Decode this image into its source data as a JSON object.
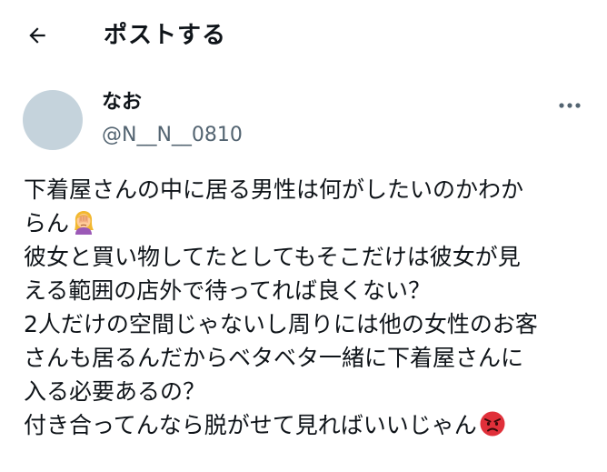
{
  "header": {
    "back_icon": "arrow-left-icon",
    "title": "ポストする"
  },
  "author": {
    "display_name": "なお",
    "handle": "@N__N__0810",
    "avatar_color": "#c5d3dc"
  },
  "more_icon": "more-horizontal-icon",
  "post": {
    "lines": [
      "下着屋さんの中に居る男性は何がしたいのかわか",
      "らん",
      "彼女と買い物してたとしてもそこだけは彼女が見",
      "える範囲の店外で待ってれば良くない？",
      "2人だけの空間じゃないし周りには他の女性のお客",
      "さんも居るんだからベタベタ一緒に下着屋さんに",
      "入る必要あるの？",
      "付き合ってんなら脱がせて見ればいいじゃん"
    ],
    "emoji_1": "facepalm-woman-emoji",
    "emoji_2": "angry-face-emoji"
  },
  "colors": {
    "text_primary": "#0f1419",
    "text_secondary": "#536471"
  }
}
